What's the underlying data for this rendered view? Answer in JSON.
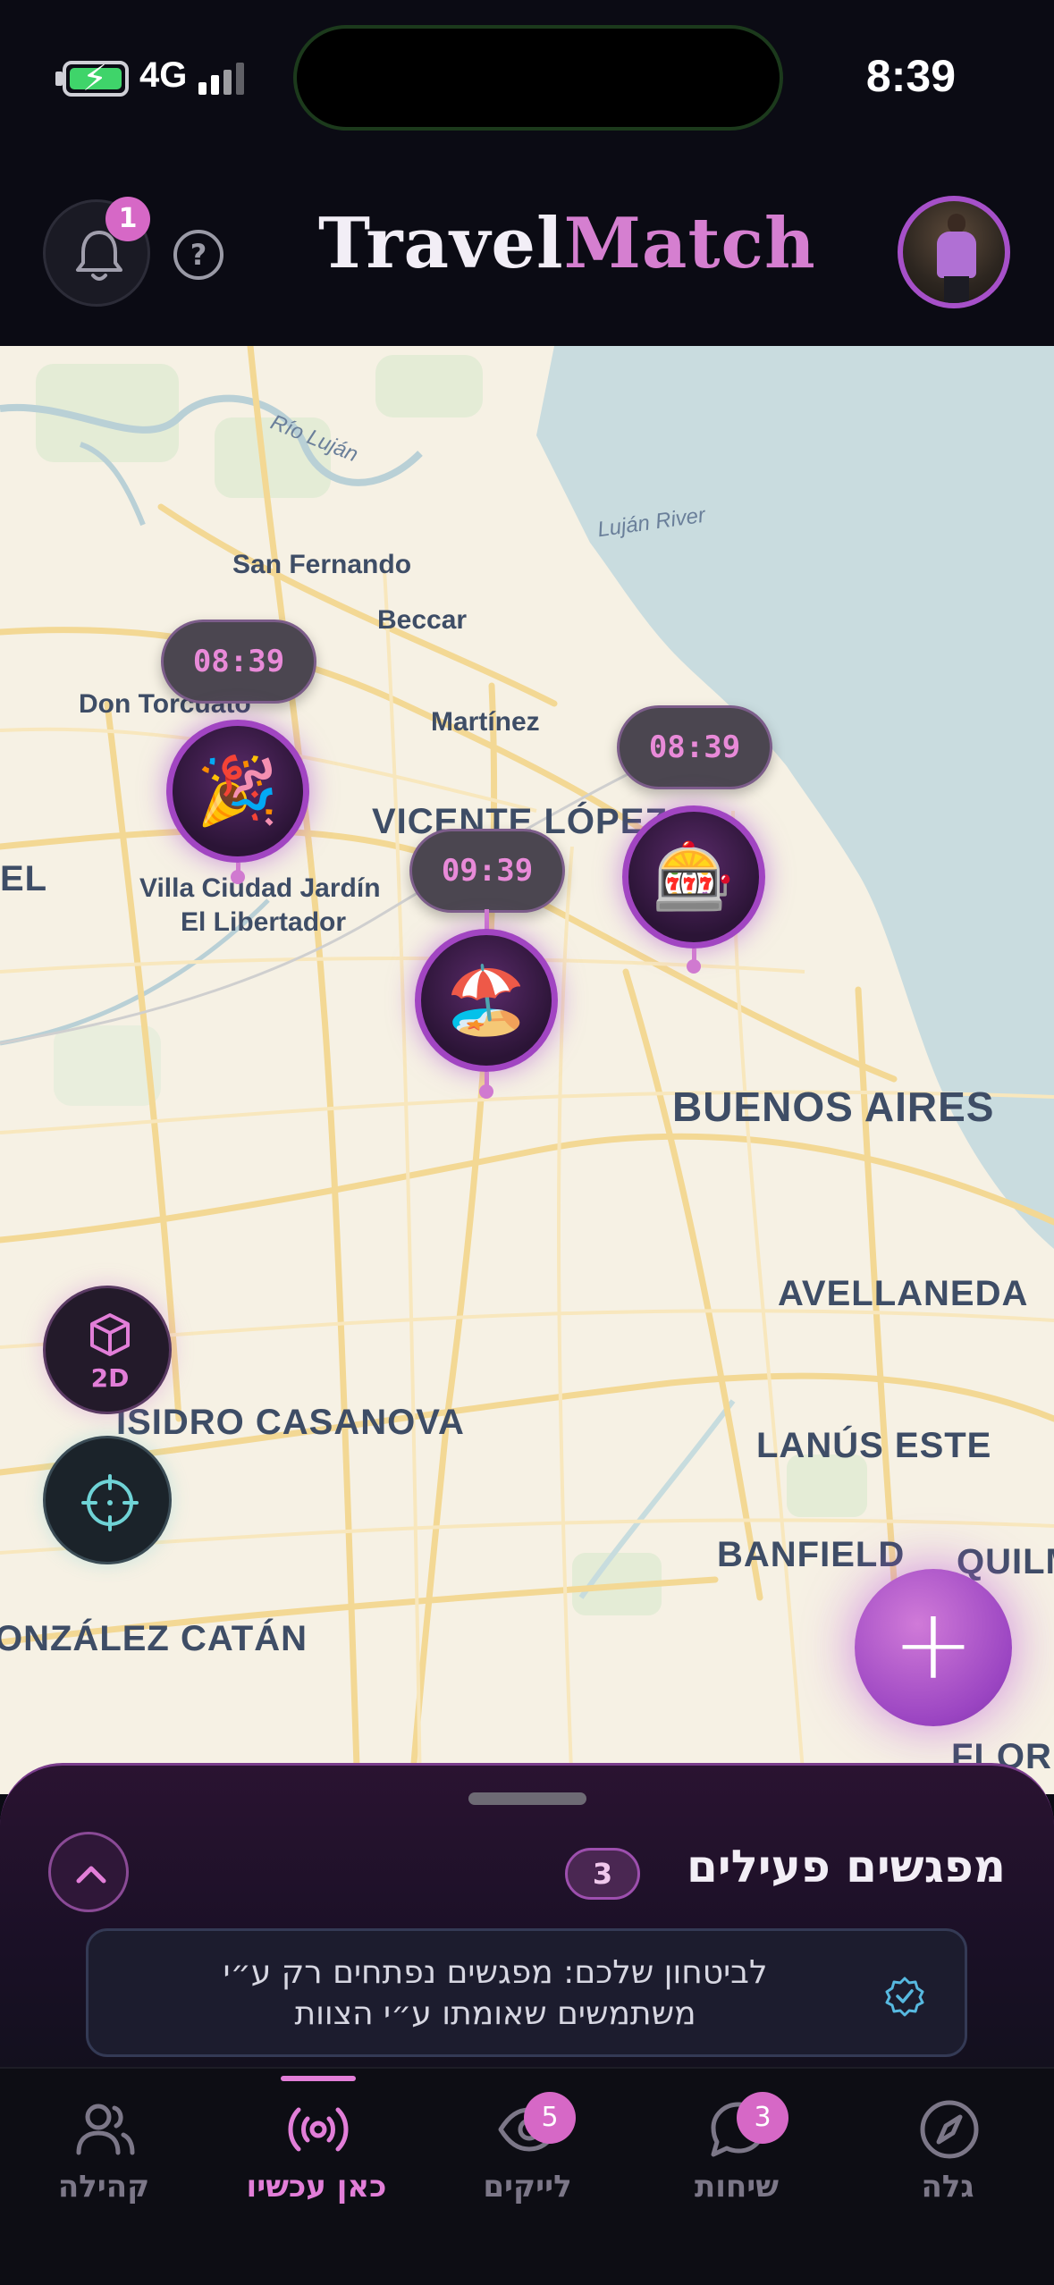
{
  "status_bar": {
    "network": "4G",
    "time": "8:39"
  },
  "header": {
    "logo_part1": "Travel",
    "logo_part2": "Match",
    "notification_count": "1",
    "help_label": "?"
  },
  "map": {
    "labels": [
      {
        "text": "Río Luján",
        "kind": "water"
      },
      {
        "text": "Luján River",
        "kind": "water"
      },
      {
        "text": "San Fernando",
        "kind": "small"
      },
      {
        "text": "Beccar",
        "kind": "small"
      },
      {
        "text": "Don Torcuato",
        "kind": "small"
      },
      {
        "text": "Martínez",
        "kind": "small"
      },
      {
        "text": "VICENTE LÓPEZ",
        "kind": "big"
      },
      {
        "text": "EL",
        "kind": "big"
      },
      {
        "text": "Villa Ciudad Jardín",
        "kind": "small"
      },
      {
        "text": "El Libertador",
        "kind": "small"
      },
      {
        "text": "BUENOS AIRES",
        "kind": "big"
      },
      {
        "text": "AVELLANEDA",
        "kind": "big"
      },
      {
        "text": "ISIDRO CASANOVA",
        "kind": "big"
      },
      {
        "text": "LANÚS ESTE",
        "kind": "big"
      },
      {
        "text": "BANFIELD",
        "kind": "big"
      },
      {
        "text": "QUILM",
        "kind": "big"
      },
      {
        "text": "ONZÁLEZ CATÁN",
        "kind": "big"
      },
      {
        "text": "FLORE",
        "kind": "big"
      }
    ],
    "pins": [
      {
        "time": "08:39",
        "emoji": "🎉",
        "name": "party"
      },
      {
        "time": "08:39",
        "emoji": "🎰",
        "name": "slot-machine"
      },
      {
        "time": "09:39",
        "emoji": "🏖️",
        "name": "beach"
      }
    ],
    "view_mode_label": "2D",
    "add_label": "+"
  },
  "sheet": {
    "title": "מפגשים פעילים",
    "count": "3",
    "safety_line1": "לביטחון שלכם: מפגשים נפתחים רק ע״י",
    "safety_line2": "משתמשים שאומתו ע״י הצוות"
  },
  "nav": {
    "items": [
      {
        "label": "קהילה",
        "icon": "users-icon",
        "active": false
      },
      {
        "label": "כאן עכשיו",
        "icon": "broadcast-icon",
        "active": true
      },
      {
        "label": "לייקים",
        "icon": "eye-icon",
        "badge": "5"
      },
      {
        "label": "שיחות",
        "icon": "chat-icon",
        "badge": "3"
      },
      {
        "label": "גלה",
        "icon": "compass-icon"
      }
    ]
  },
  "colors": {
    "accent": "#d668c6",
    "brand_purple": "#a145c2",
    "background": "#0b0b14",
    "map_land": "#f6f1e4",
    "map_water": "#c9dcdf"
  }
}
